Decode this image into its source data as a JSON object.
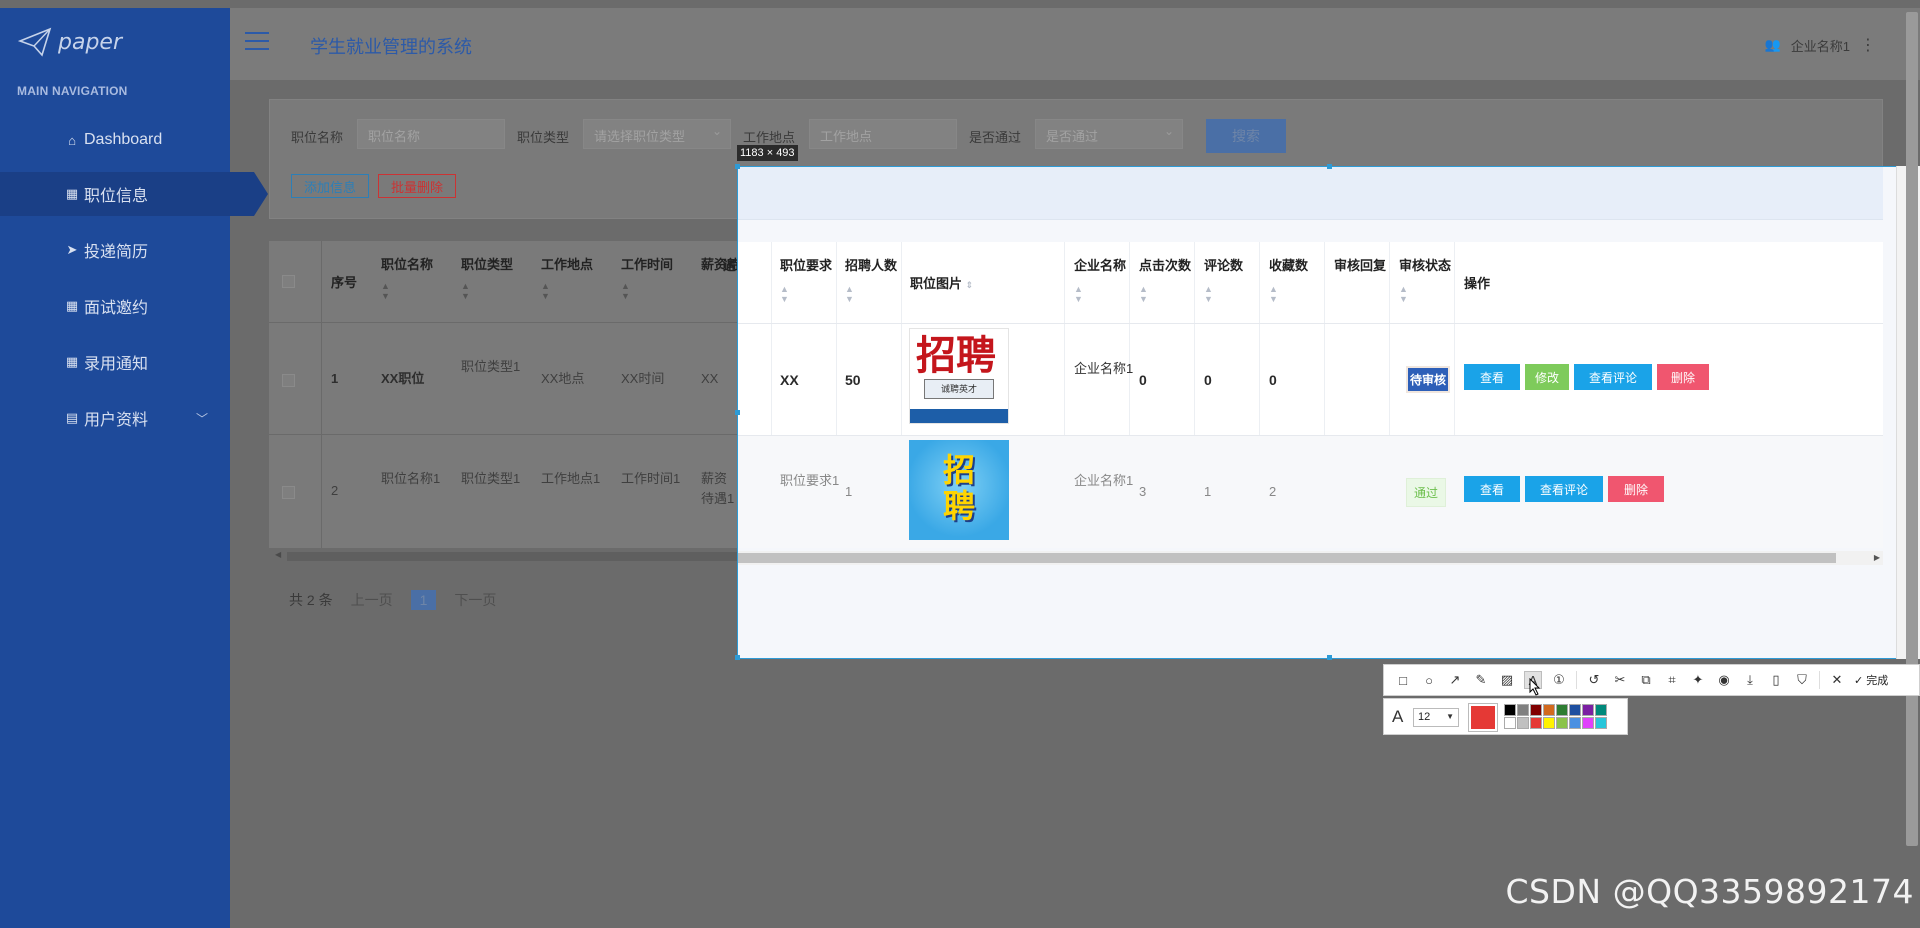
{
  "sidebar": {
    "logo_text": "paper",
    "heading": "MAIN NAVIGATION",
    "items": [
      {
        "label": "Dashboard",
        "icon": "home-icon"
      },
      {
        "label": "职位信息",
        "icon": "grid-icon",
        "active": true
      },
      {
        "label": "投递简历",
        "icon": "send-icon"
      },
      {
        "label": "面试邀约",
        "icon": "grid-icon"
      },
      {
        "label": "录用通知",
        "icon": "grid-icon"
      },
      {
        "label": "用户资料",
        "icon": "calendar-icon",
        "expandable": true
      }
    ]
  },
  "header": {
    "title": "学生就业管理的系统",
    "user_name": "企业名称1"
  },
  "search": {
    "job_name_label": "职位名称",
    "job_name_placeholder": "职位名称",
    "job_type_label": "职位类型",
    "job_type_placeholder": "请选择职位类型",
    "location_label": "工作地点",
    "location_placeholder": "工作地点",
    "passed_label": "是否通过",
    "passed_placeholder": "是否通过",
    "search_button": "搜索",
    "add_button": "添加信息",
    "batch_delete_button": "批量删除"
  },
  "table": {
    "columns": [
      "序号",
      "职位名称",
      "职位类型",
      "工作地点",
      "工作时间",
      "薪资待遇",
      "职位要求",
      "招聘人数",
      "职位图片",
      "企业名称",
      "点击次数",
      "评论数",
      "收藏数",
      "审核回复",
      "审核状态",
      "操作"
    ],
    "rows": [
      {
        "index": "1",
        "name": "XX职位",
        "type": "职位类型1",
        "location": "XX地点",
        "time": "XX时间",
        "salary": "XX",
        "requirement": "XX",
        "count": "50",
        "image_text": "招聘",
        "image_sub": "诚聘英才",
        "company": "企业名称1",
        "clicks": "0",
        "comments": "0",
        "favorites": "0",
        "reply": "",
        "status": "待审核",
        "actions": [
          "查看",
          "修改",
          "查看评论",
          "删除"
        ]
      },
      {
        "index": "2",
        "name": "职位名称1",
        "type": "职位类型1",
        "location": "工作地点1",
        "time": "工作时间1",
        "salary": "薪资待遇1",
        "requirement": "职位要求1",
        "count": "1",
        "image_text": "招聘",
        "company": "企业名称1",
        "clicks": "3",
        "comments": "1",
        "favorites": "2",
        "reply": "",
        "status": "通过",
        "actions": [
          "查看",
          "查看评论",
          "删除"
        ]
      }
    ]
  },
  "pager": {
    "total": "共 2 条",
    "prev": "上一页",
    "current": "1",
    "next": "下一页"
  },
  "capture": {
    "dims": "1183 × 493"
  },
  "snap_toolbar": {
    "done_label": "完成",
    "font_size": "12",
    "icons": [
      "rectangle-icon",
      "ellipse-icon",
      "arrow-icon",
      "pen-icon",
      "mosaic-icon",
      "text-icon",
      "number-icon",
      "undo-icon",
      "cut-icon",
      "copy-icon",
      "ocr-icon",
      "pin-icon",
      "record-icon",
      "download-icon",
      "save-icon",
      "bookmark-icon",
      "close-icon"
    ],
    "current_color": "#e53935",
    "palette": [
      "#000000",
      "#808080",
      "#800000",
      "#d2691e",
      "#2e7d32",
      "#1e4fa0",
      "#7b1fa2",
      "#00897b",
      "#ffffff",
      "#c0c0c0",
      "#e53935",
      "#fff200",
      "#8bc34a",
      "#4a90e2",
      "#e040fb",
      "#26c6da"
    ]
  },
  "watermark": "CSDN @QQ3359892174"
}
